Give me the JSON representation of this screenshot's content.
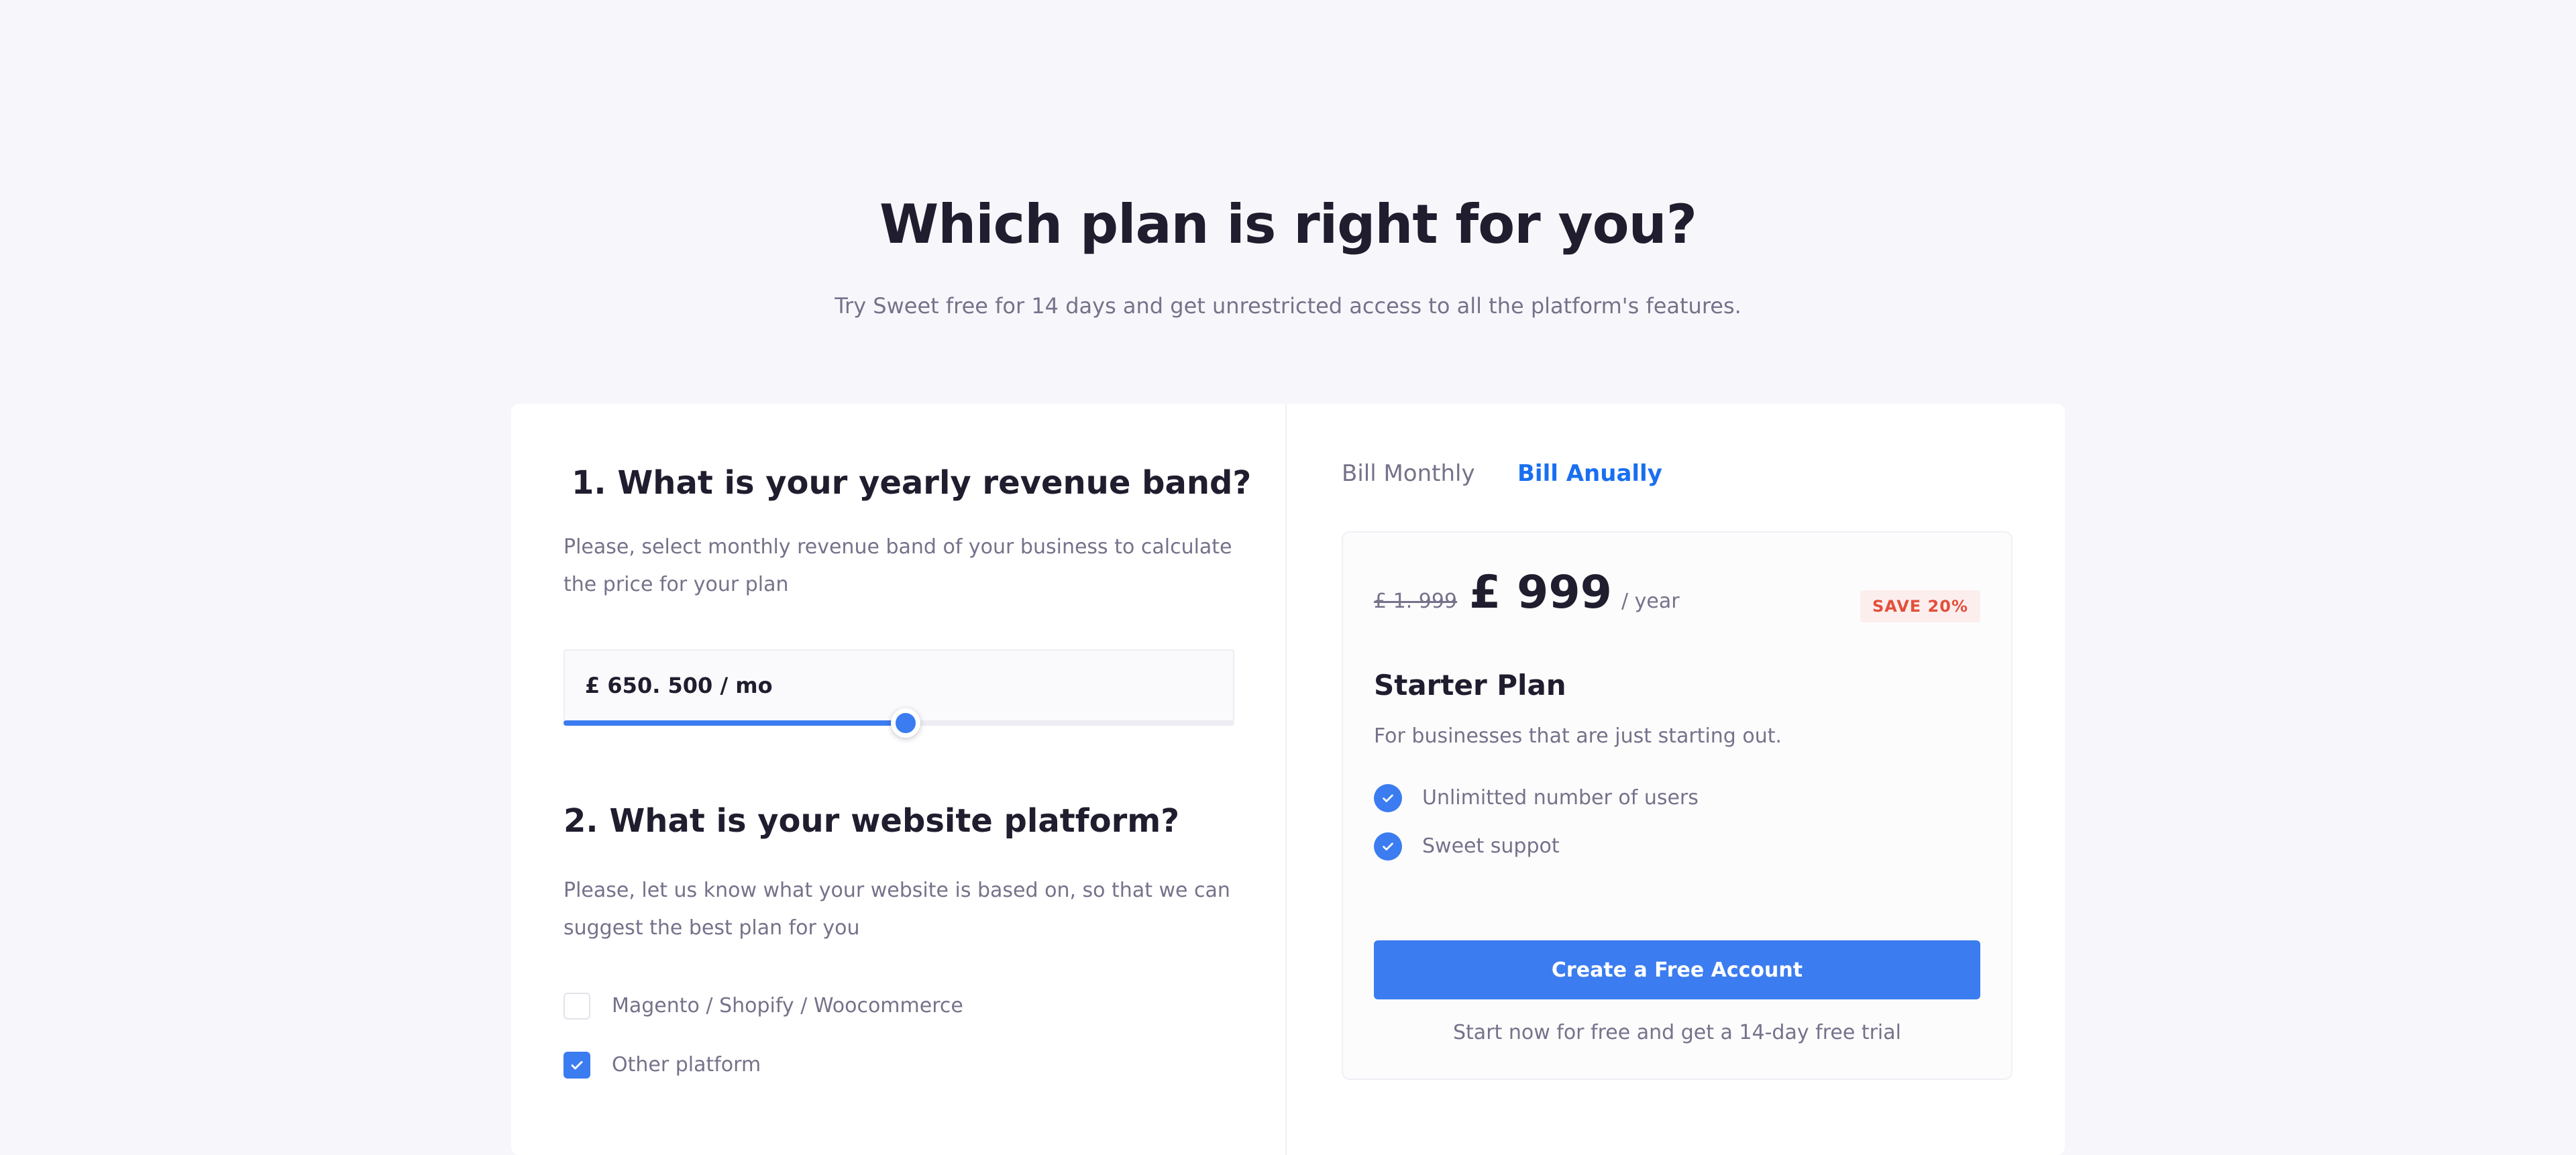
{
  "header": {
    "title": "Which plan is right for you?",
    "subtitle": "Try Sweet free for 14 days and get unrestricted access to all the platform's features."
  },
  "revenue_section": {
    "title": "1. What is your yearly revenue band?",
    "description": "Please, select monthly revenue band of your business to calculate the price for your plan",
    "value": "£ 650. 500 / mo",
    "slider_fraction": 0.51
  },
  "platform_section": {
    "title": "2. What is your website platform?",
    "description": "Please, let us know what your website is based on, so that we can suggest the best plan for you",
    "options": [
      {
        "label": "Magento / Shopify / Woocommerce",
        "checked": false
      },
      {
        "label": "Other platform",
        "checked": true
      }
    ]
  },
  "billing": {
    "monthly_label": "Bill Monthly",
    "annual_label": "Bill Anually",
    "selected": "annual"
  },
  "plan": {
    "old_price": "£ 1. 999",
    "price": "£ 999",
    "period": "/ year",
    "save_badge": "SAVE 20%",
    "name": "Starter Plan",
    "description": "For businesses that are just starting out.",
    "features": [
      "Unlimitted number of users",
      "Sweet suppot"
    ],
    "cta_label": "Create a Free Account",
    "cta_note": "Start now for free and get a 14-day free trial"
  },
  "colors": {
    "accent": "#3b7cf0",
    "accent_text": "#1a6ff0",
    "badge_text": "#e2503a",
    "badge_bg": "#fdeeee"
  },
  "icons": {
    "checkbox_check": "check-icon",
    "feature_check": "check-circle-icon"
  }
}
